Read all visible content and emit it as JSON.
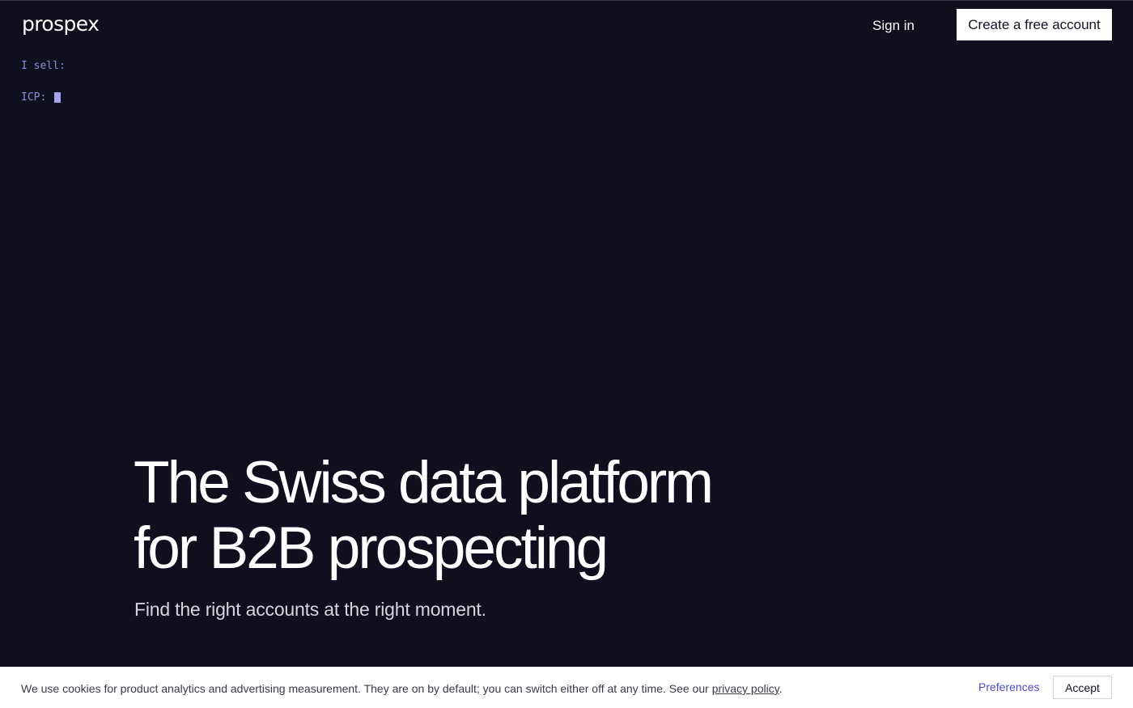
{
  "header": {
    "logo": "prospex",
    "signin_label": "Sign in",
    "cta_label": "Create a free account"
  },
  "terminal": {
    "sell_label": "I sell:",
    "icp_label": "ICP:"
  },
  "hero": {
    "title_line1": "The Swiss data platform",
    "title_line2": "for B2B prospecting",
    "subtitle": "Find the right accounts at the right moment."
  },
  "cookie": {
    "text_before": "We use cookies for product analytics and advertising measurement. They are on by default; you can switch either off at any time. See our ",
    "link_text": "privacy policy",
    "text_after": ".",
    "preferences_label": "Preferences",
    "accept_label": "Accept"
  },
  "colors": {
    "background": "#100f1f",
    "accent": "#8f8dd6",
    "link": "#4f4dc8"
  }
}
